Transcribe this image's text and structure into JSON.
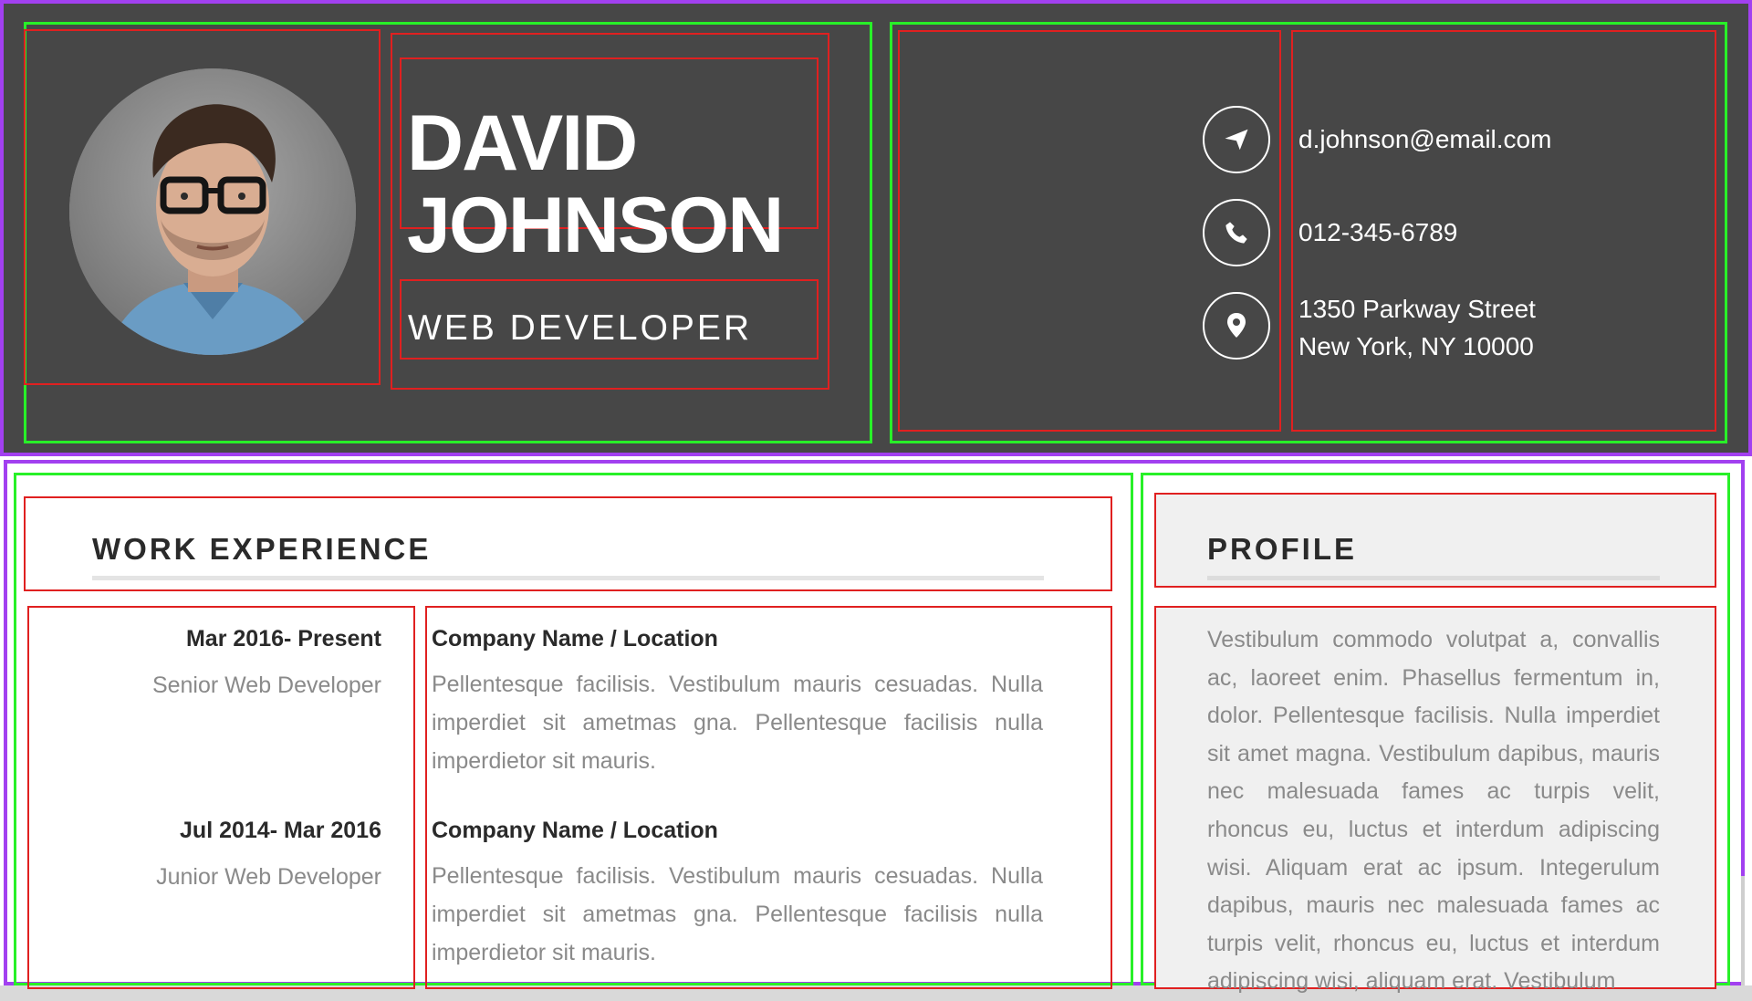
{
  "header": {
    "name_line1": "DAVID",
    "name_line2": "JOHNSON",
    "job_title": "WEB DEVELOPER",
    "contacts": [
      {
        "icon": "paper-plane-icon",
        "text": "d.johnson@email.com"
      },
      {
        "icon": "phone-icon",
        "text": "012-345-6789"
      },
      {
        "icon": "map-pin-icon",
        "line1": "1350 Parkway Street",
        "line2": "New York, NY 10000"
      }
    ]
  },
  "work": {
    "title": "WORK EXPERIENCE",
    "jobs": [
      {
        "date": "Mar 2016- Present",
        "role": "Senior Web Developer",
        "company": "Company Name / Location",
        "description": "Pellentesque facilisis. Vestibulum mauris cesuadas. Nulla imperdiet sit ametmas gna. Pellentesque facilisis nulla imperdietor sit mauris."
      },
      {
        "date": "Jul 2014- Mar 2016",
        "role": "Junior Web Developer",
        "company": "Company Name / Location",
        "description": "Pellentesque facilisis. Vestibulum mauris cesuadas. Nulla imperdiet sit ametmas gna. Pellentesque facilisis nulla imperdietor sit mauris."
      }
    ]
  },
  "profile": {
    "title": "PROFILE",
    "text": "Vestibulum commodo volutpat a, convallis ac, laoreet enim. Phasellus fermentum in, dolor. Pellentesque facilisis. Nulla imperdiet sit amet magna. Vestibulum dapibus, mauris nec malesuada fames ac turpis velit, rhoncus eu, luctus et interdum adipiscing wisi. Aliquam erat ac ipsum. Integerulum dapibus, mauris nec malesuada fames ac turpis velit, rhoncus eu, luctus et interdum adipiscing wisi, aliquam erat. Vestibulum"
  },
  "colors": {
    "header_bg": "#474747",
    "annotation_purple": "#a240f0",
    "annotation_green": "#28f028",
    "annotation_red": "#e02020",
    "profile_bg": "#f0f0f0"
  }
}
